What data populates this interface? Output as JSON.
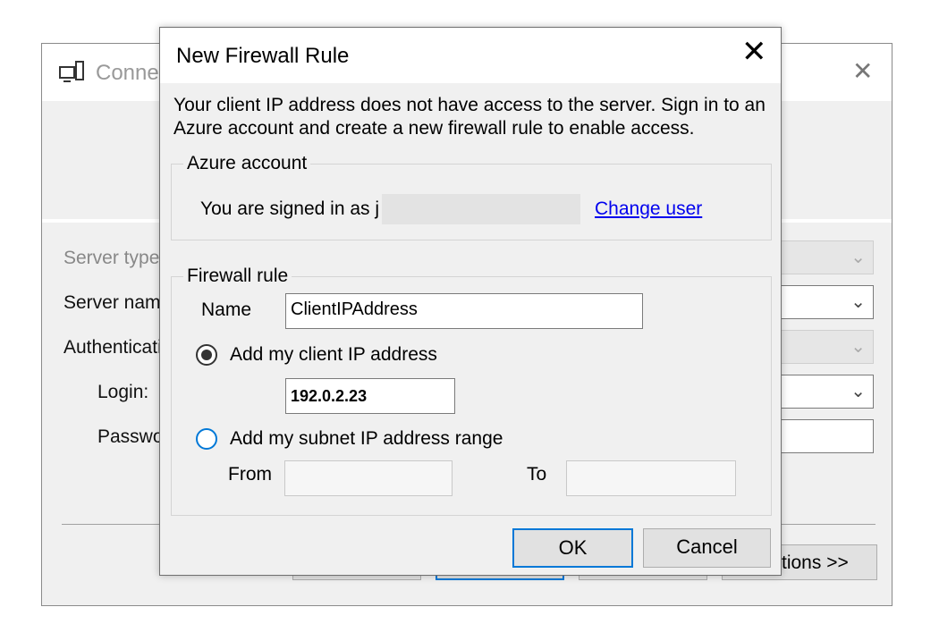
{
  "background_window": {
    "title": "Conne",
    "labels": {
      "server_type": "Server type",
      "server_name": "Server nam",
      "authentication": "Authenticati",
      "login": "Login:",
      "password": "Passwo"
    },
    "options_button": "tions >>"
  },
  "dialog": {
    "title": "New Firewall Rule",
    "message": "Your client IP address does not have access to the server. Sign in to an Azure account and create a new firewall rule to enable access.",
    "azure_account": {
      "legend": "Azure account",
      "signed_in_text": "You are signed in as j",
      "change_user_link": "Change user"
    },
    "firewall_rule": {
      "legend": "Firewall rule",
      "name_label": "Name",
      "name_value": "ClientIPAddress",
      "option_client_ip": "Add my client IP address",
      "client_ip_value": "192.0.2.23",
      "option_subnet": "Add my subnet IP address range",
      "from_label": "From",
      "to_label": "To",
      "selected_option": "client_ip"
    },
    "buttons": {
      "ok": "OK",
      "cancel": "Cancel"
    }
  },
  "colors": {
    "accent": "#0078d7",
    "link": "#0000ee",
    "dialog_bg": "#f0f0f0"
  }
}
